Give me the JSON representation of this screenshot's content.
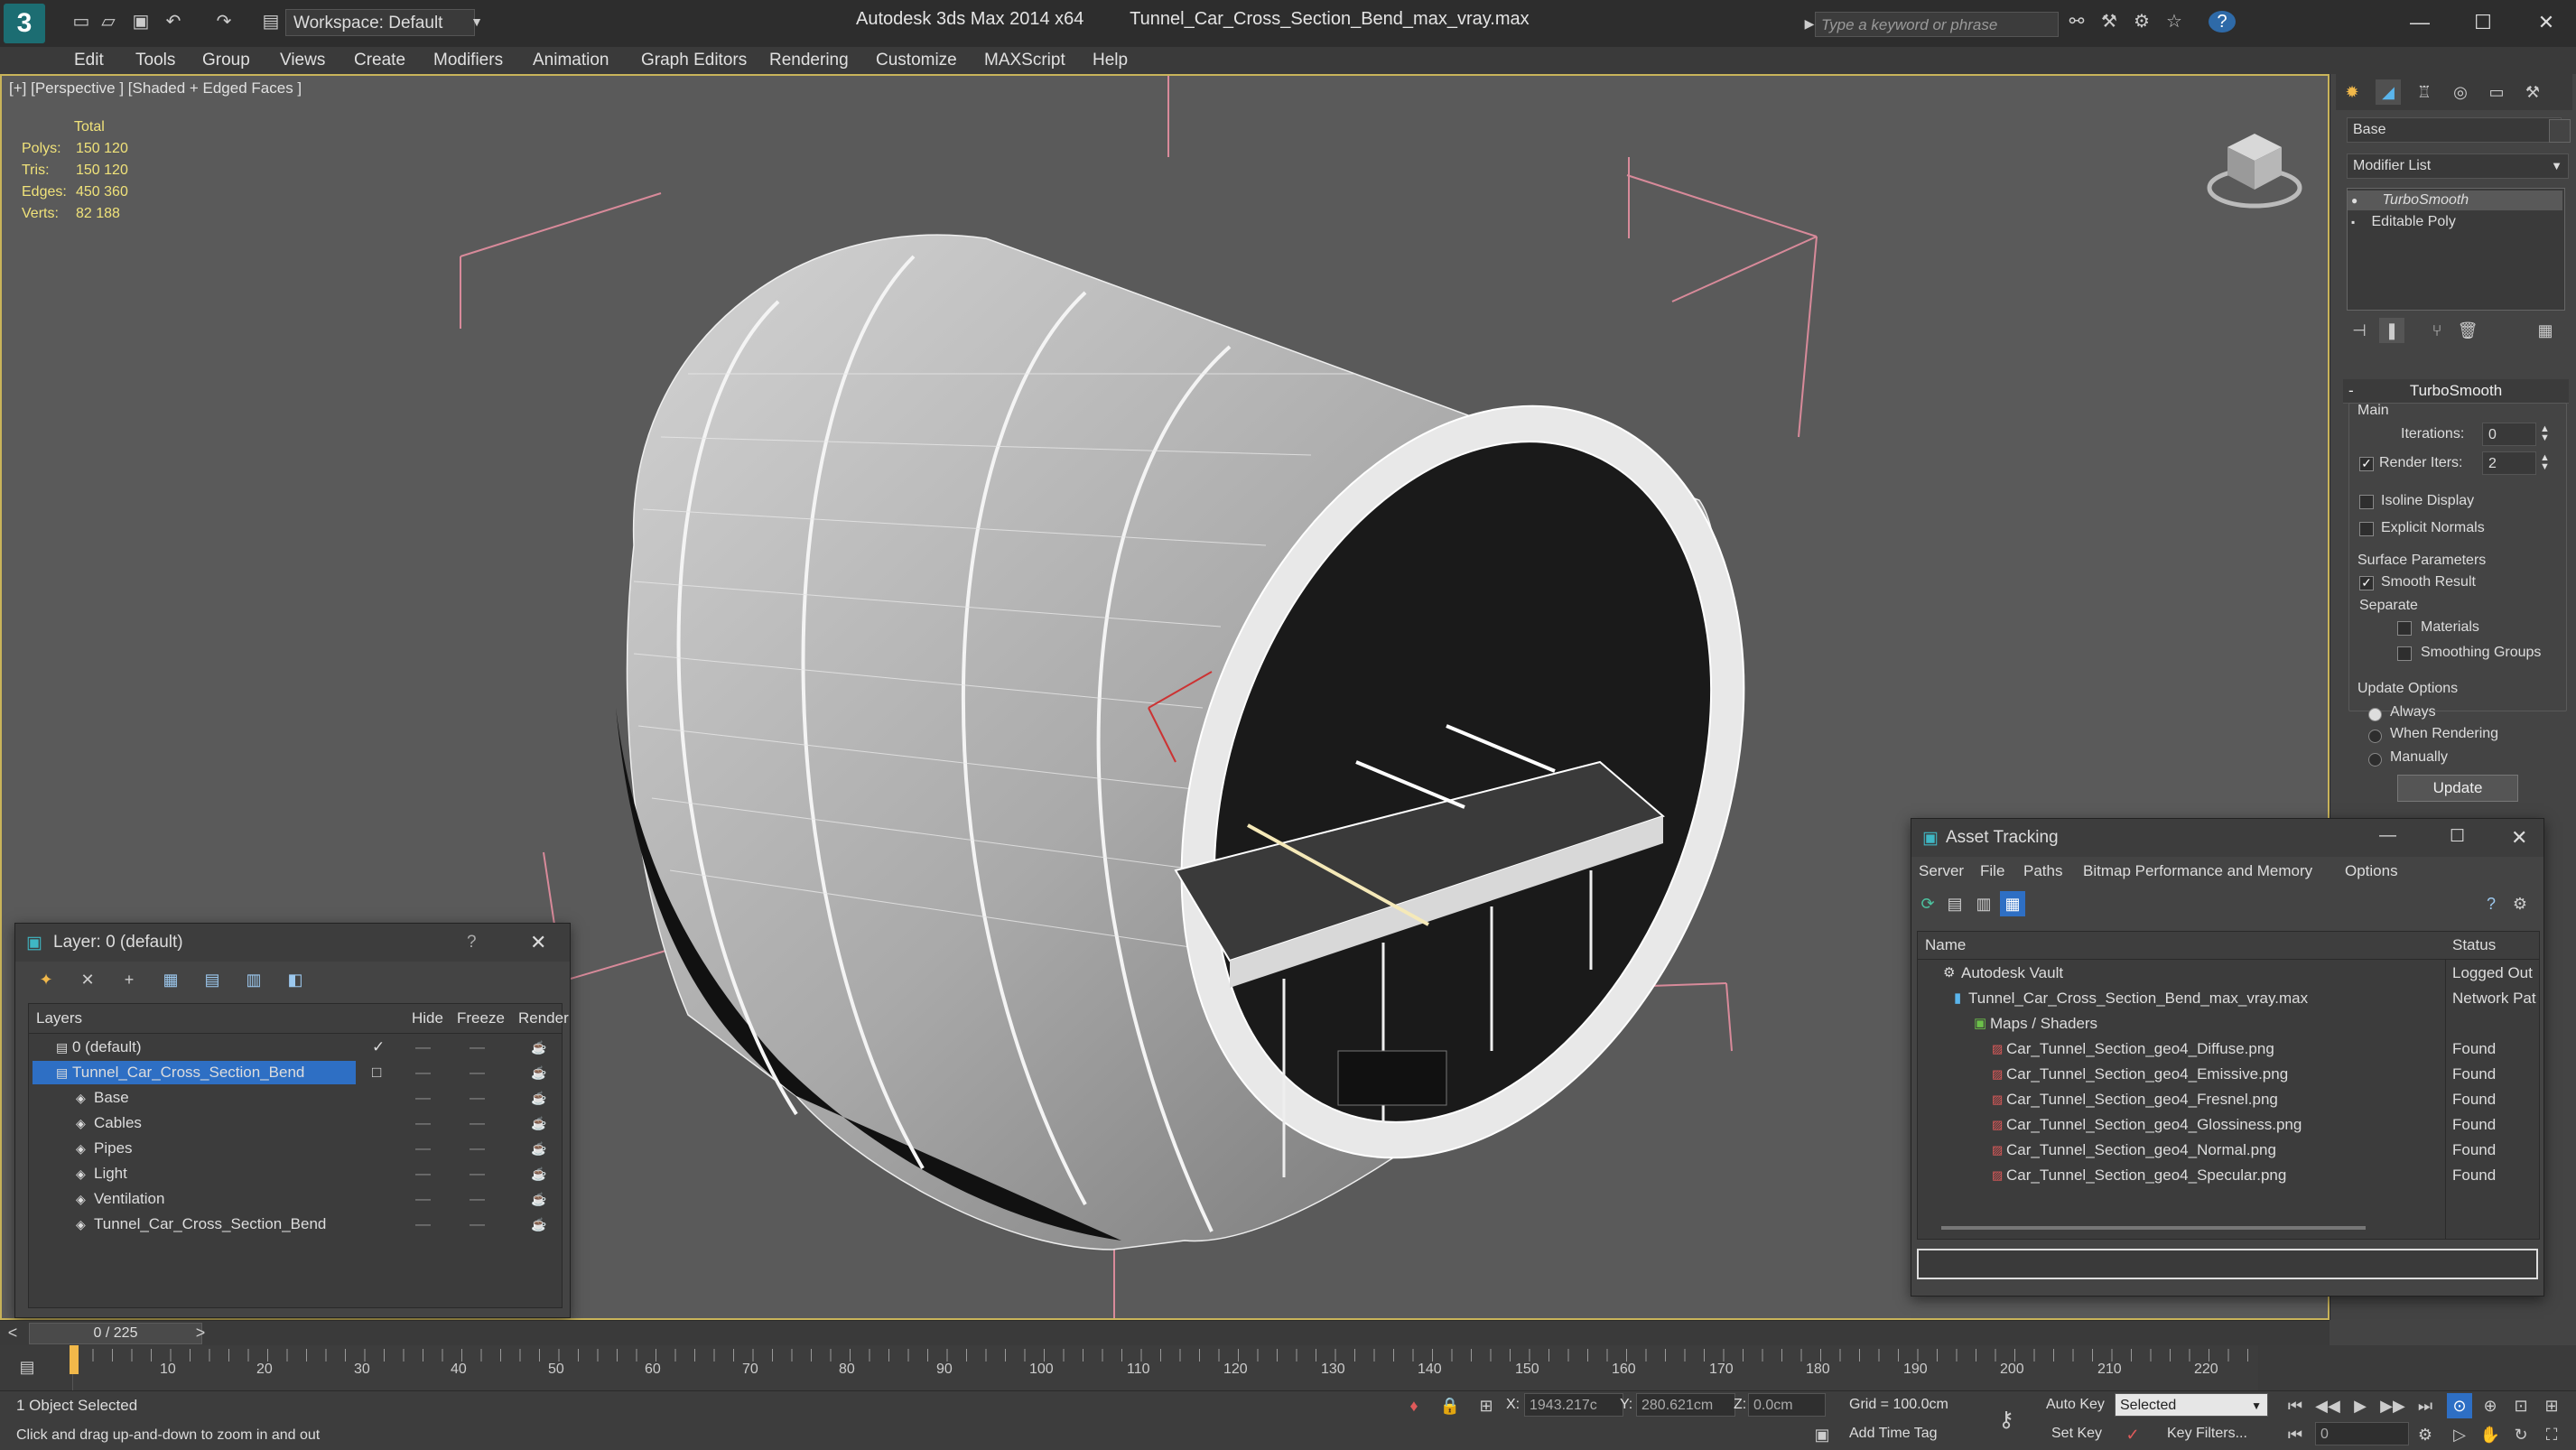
{
  "app": {
    "title": "Autodesk 3ds Max  2014 x64",
    "file": "Tunnel_Car_Cross_Section_Bend_max_vray.max",
    "workspace": "Workspace: Default",
    "search_placeholder": "Type a keyword or phrase"
  },
  "menu": [
    "Edit",
    "Tools",
    "Group",
    "Views",
    "Create",
    "Modifiers",
    "Animation",
    "Graph Editors",
    "Rendering",
    "Customize",
    "MAXScript",
    "Help"
  ],
  "viewport": {
    "label": "[+] [Perspective ] [Shaded + Edged Faces ]",
    "stats": {
      "header": "Total",
      "rows": [
        {
          "label": "Polys:",
          "value": "150 120"
        },
        {
          "label": "Tris:",
          "value": "150 120"
        },
        {
          "label": "Edges:",
          "value": "450 360"
        },
        {
          "label": "Verts:",
          "value": "82 188"
        }
      ]
    }
  },
  "command_panel": {
    "object_name": "Base",
    "modifier_list": "Modifier List",
    "stack": [
      "TurboSmooth",
      "Editable Poly"
    ],
    "rollout_title": "TurboSmooth",
    "main_label": "Main",
    "iterations_label": "Iterations:",
    "iterations_value": "0",
    "render_iters_label": "Render Iters:",
    "render_iters_value": "2",
    "isoline": "Isoline Display",
    "explicit_normals": "Explicit Normals",
    "surface_params": "Surface Parameters",
    "smooth_result": "Smooth Result",
    "separate": "Separate",
    "materials": "Materials",
    "smoothing_groups": "Smoothing Groups",
    "update_options": "Update Options",
    "always": "Always",
    "when_rendering": "When Rendering",
    "manually": "Manually",
    "update_button": "Update"
  },
  "layer_window": {
    "title": "Layer: 0 (default)",
    "columns": [
      "Layers",
      "Hide",
      "Freeze",
      "Render"
    ],
    "layers": [
      {
        "name": "0 (default)",
        "level": 0
      },
      {
        "name": "Tunnel_Car_Cross_Section_Bend",
        "level": 0,
        "selected": true
      },
      {
        "name": "Base",
        "level": 1
      },
      {
        "name": "Cables",
        "level": 1
      },
      {
        "name": "Pipes",
        "level": 1
      },
      {
        "name": "Light",
        "level": 1
      },
      {
        "name": "Ventilation",
        "level": 1
      },
      {
        "name": "Tunnel_Car_Cross_Section_Bend",
        "level": 1
      }
    ]
  },
  "asset_window": {
    "title": "Asset Tracking",
    "menu": [
      "Server",
      "File",
      "Paths",
      "Bitmap Performance and Memory",
      "Options"
    ],
    "columns": [
      "Name",
      "Status"
    ],
    "rows": [
      {
        "name": "Autodesk Vault",
        "status": "Logged Out",
        "level": 0
      },
      {
        "name": "Tunnel_Car_Cross_Section_Bend_max_vray.max",
        "status": "Network Pat",
        "level": 1
      },
      {
        "name": "Maps / Shaders",
        "status": "",
        "level": 2
      },
      {
        "name": "Car_Tunnel_Section_geo4_Diffuse.png",
        "status": "Found",
        "level": 3
      },
      {
        "name": "Car_Tunnel_Section_geo4_Emissive.png",
        "status": "Found",
        "level": 3
      },
      {
        "name": "Car_Tunnel_Section_geo4_Fresnel.png",
        "status": "Found",
        "level": 3
      },
      {
        "name": "Car_Tunnel_Section_geo4_Glossiness.png",
        "status": "Found",
        "level": 3
      },
      {
        "name": "Car_Tunnel_Section_geo4_Normal.png",
        "status": "Found",
        "level": 3
      },
      {
        "name": "Car_Tunnel_Section_geo4_Specular.png",
        "status": "Found",
        "level": 3
      }
    ]
  },
  "timeline": {
    "frame_label": "0 / 225",
    "ticks": [
      "10",
      "20",
      "30",
      "40",
      "50",
      "60",
      "70",
      "80",
      "90",
      "100",
      "110",
      "120",
      "130",
      "140",
      "150",
      "160",
      "170",
      "180",
      "190",
      "200",
      "210",
      "220"
    ]
  },
  "status": {
    "selected": "1 Object Selected",
    "prompt": "Click and drag up-and-down to zoom in and out",
    "x_label": "X:",
    "x_value": "1943.217c",
    "y_label": "Y:",
    "y_value": "280.621cm",
    "z_label": "Z:",
    "z_value": "0.0cm",
    "grid": "Grid = 100.0cm",
    "add_time_tag": "Add Time Tag",
    "auto_key": "Auto Key",
    "auto_key_value": "Selected",
    "set_key": "Set Key",
    "key_filters": "Key Filters...",
    "frame_value": "0"
  }
}
